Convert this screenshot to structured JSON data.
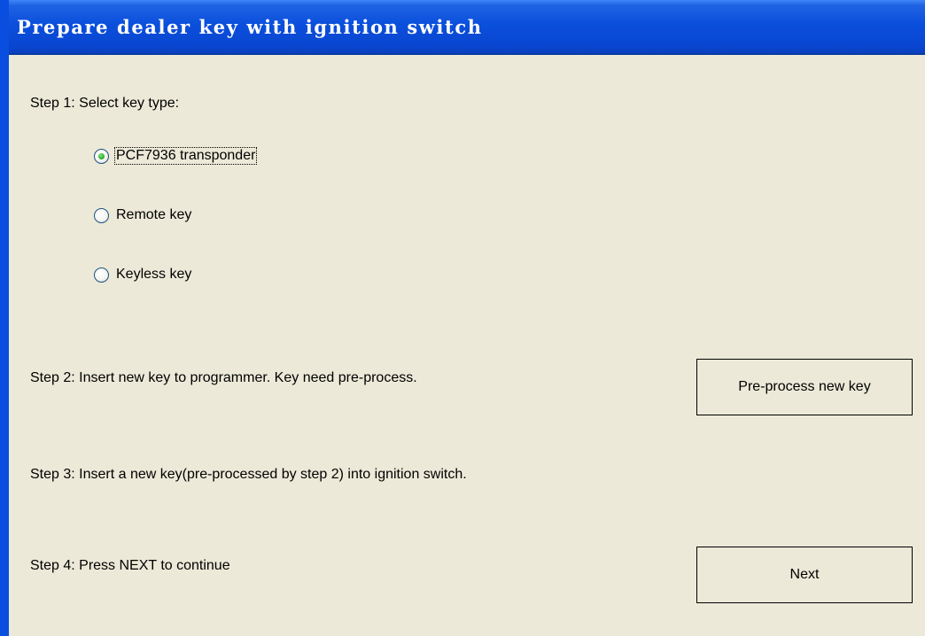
{
  "window": {
    "title": "Prepare dealer key with ignition switch"
  },
  "step1": {
    "label": "Step 1: Select key type:",
    "options": [
      {
        "label": "PCF7936 transponder",
        "selected": true
      },
      {
        "label": "Remote key",
        "selected": false
      },
      {
        "label": "Keyless key",
        "selected": false
      }
    ]
  },
  "step2": {
    "label": "Step 2: Insert new key to programmer. Key need pre-process.",
    "button_label": "Pre-process new key"
  },
  "step3": {
    "label": "Step 3: Insert a new key(pre-processed by step 2) into ignition switch."
  },
  "step4": {
    "label": "Step 4: Press NEXT to continue",
    "button_label": "Next"
  },
  "colors": {
    "titlebar": "#0a4fdc",
    "window_bg": "#ece9d8",
    "radio_dot": "#31b531"
  }
}
